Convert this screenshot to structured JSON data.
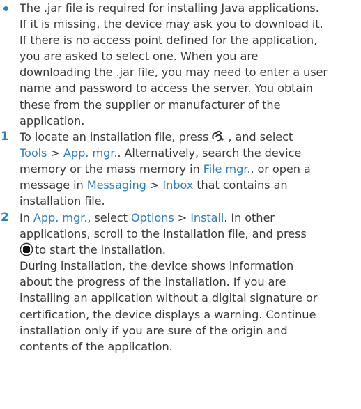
{
  "bullet": {
    "lines": [
      "The .jar file is required for installing Java applications.",
      "If it is missing, the device may ask you to download it.",
      "If there is no access point defined for the application,",
      "you are asked to select one. When you are",
      "downloading the .jar file, you may need to enter a user",
      "name and password to access the server. You obtain",
      "these from the supplier or manufacturer of the",
      "application."
    ]
  },
  "step1": {
    "number": "1",
    "t1": "To locate an installation file, press",
    "menu_key_icon": "menu-key-icon",
    "t2": ", and select",
    "tools": "Tools",
    "sep1": " > ",
    "app_mgr": "App. mgr.",
    "t3": ". Alternatively, search the device",
    "t4": "memory or the mass memory in",
    "file_mgr": "File mgr.",
    "t5": ", or open a",
    "t6": "message in",
    "messaging": "Messaging",
    "sep2": " > ",
    "inbox": "Inbox",
    "t7": " that contains an",
    "t8": "installation file."
  },
  "step2": {
    "number": "2",
    "t1": "In",
    "app_mgr": "App. mgr.",
    "t2": ", select",
    "options": "Options",
    "sep": " > ",
    "install": "Install",
    "t3": ". In other",
    "t4": "applications, scroll to the installation file, and press",
    "select_key_icon": "select-key-icon",
    "t5": "to start the installation.",
    "para_lines": [
      "During installation, the device shows information",
      "about the progress of the installation. If you are",
      "installing an application without a digital signature or",
      "certification, the device displays a warning. Continue",
      "installation only if you are sure of the origin and",
      "contents of the application."
    ]
  },
  "colors": {
    "accent": "#2f7fc4",
    "text": "#3b3b3b",
    "background": "#ffffff"
  }
}
